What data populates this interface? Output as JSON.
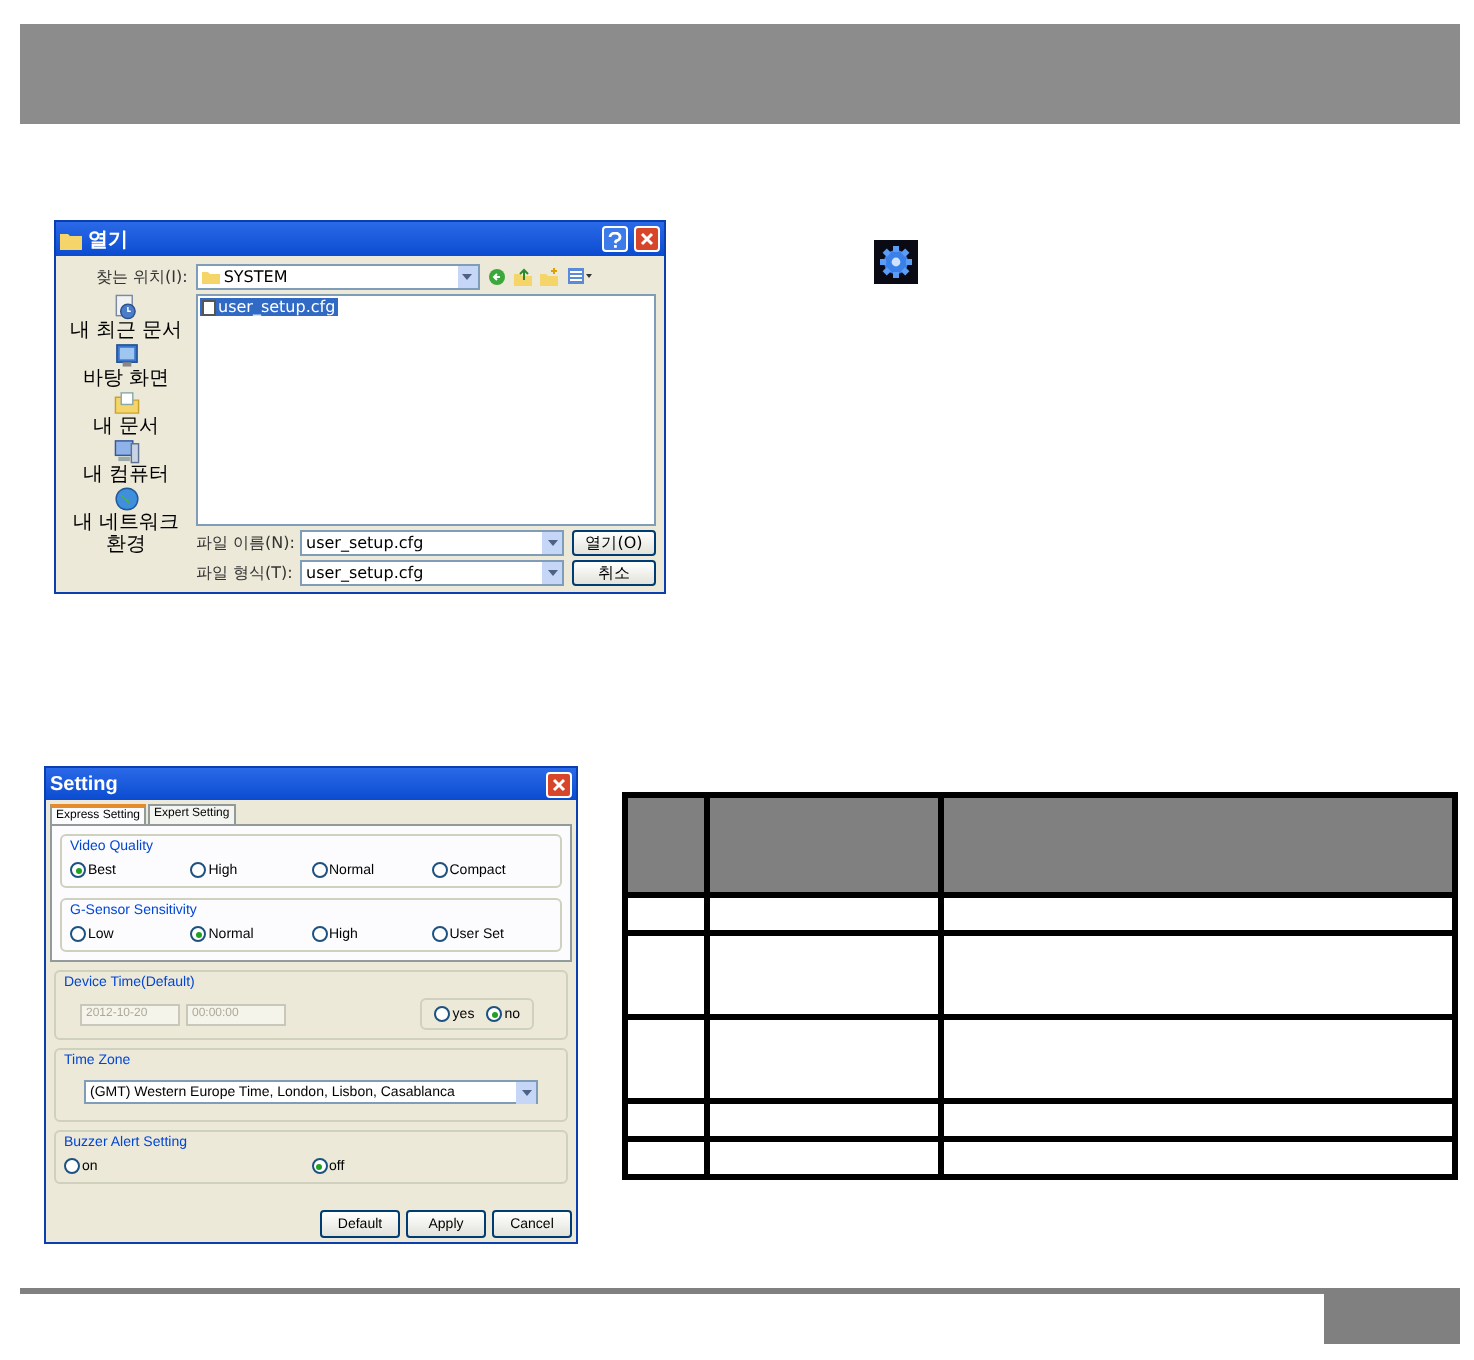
{
  "open_dialog": {
    "title": "열기",
    "look_in_label": "찾는 위치(I):",
    "look_in": "SYSTEM",
    "files": [
      {
        "name": "user_setup.cfg",
        "selected": true
      }
    ],
    "places": [
      {
        "label": "내 최근 문서",
        "kind": "recent"
      },
      {
        "label": "바탕 화면",
        "kind": "desktop"
      },
      {
        "label": "내 문서",
        "kind": "documents"
      },
      {
        "label": "내 컴퓨터",
        "kind": "computer"
      },
      {
        "label": "내 네트워크 환경",
        "kind": "network"
      }
    ],
    "file_name_label": "파일 이름(N):",
    "file_name": "user_setup.cfg",
    "file_type_label": "파일 형식(T):",
    "file_type": "user_setup.cfg",
    "buttons": [
      "열기(O)",
      "취소"
    ]
  },
  "settings_dialog": {
    "title": "Setting",
    "tabs": [
      {
        "label": "Express Setting",
        "selected": true
      },
      {
        "label": "Expert Setting",
        "selected": false
      }
    ],
    "video_quality": {
      "title": "Video Quality",
      "options": [
        {
          "label": "Best",
          "selected": true
        },
        {
          "label": "High",
          "selected": false
        },
        {
          "label": "Normal",
          "selected": false
        },
        {
          "label": "Compact",
          "selected": false
        }
      ]
    },
    "g_sensor": {
      "title": "G-Sensor Sensitivity",
      "options": [
        {
          "label": "Low",
          "selected": false
        },
        {
          "label": "Normal",
          "selected": true
        },
        {
          "label": "High",
          "selected": false
        },
        {
          "label": "User Set",
          "selected": false
        }
      ]
    },
    "device_time": {
      "title": "Device Time(Default)",
      "disabled": true,
      "date": "2012-10-20",
      "time": "00:00:00",
      "options": [
        {
          "label": "yes",
          "selected": false
        },
        {
          "label": "no",
          "selected": true
        }
      ]
    },
    "time_zone": {
      "title": "Time Zone",
      "value": "(GMT) Western Europe Time, London, Lisbon, Casablanca"
    },
    "buzzer": {
      "title": "Buzzer Alert Setting",
      "options": [
        {
          "label": "on",
          "selected": false
        },
        {
          "label": "off",
          "selected": true
        }
      ]
    },
    "buttons": [
      "Default",
      "Apply",
      "Cancel"
    ]
  },
  "table": {
    "rows": [
      {
        "kind": "header"
      },
      {
        "kind": "single"
      },
      {
        "kind": "double"
      },
      {
        "kind": "double"
      },
      {
        "kind": "single"
      },
      {
        "kind": "single"
      }
    ]
  }
}
